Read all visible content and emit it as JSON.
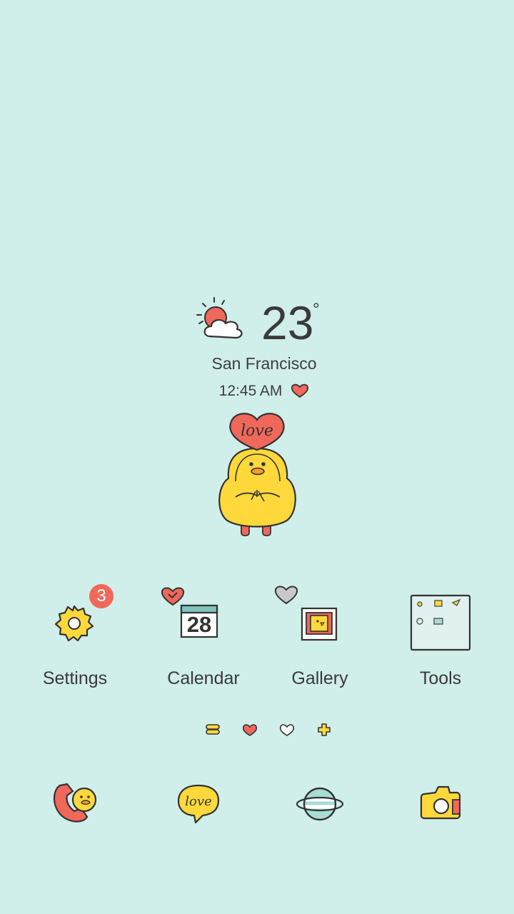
{
  "weather": {
    "icon": "sun-behind-cloud-icon",
    "temperature": "23",
    "degree": "°",
    "city": "San Francisco"
  },
  "clock": {
    "time": "12:45 AM",
    "icon": "heart-icon"
  },
  "mascot": {
    "icon": "duck-holding-love-heart-icon",
    "heart_text": "love"
  },
  "apps": [
    {
      "label": "Settings",
      "icon": "gear-icon",
      "badge": "3"
    },
    {
      "label": "Calendar",
      "icon": "calendar-icon",
      "date": "28"
    },
    {
      "label": "Gallery",
      "icon": "photo-frame-icon"
    },
    {
      "label": "Tools",
      "icon": "tools-folder-icon"
    }
  ],
  "page_indicator": [
    {
      "icon": "yellow-dash-icon"
    },
    {
      "icon": "red-heart-icon"
    },
    {
      "icon": "white-heart-icon"
    },
    {
      "icon": "yellow-cross-icon"
    }
  ],
  "dock": [
    {
      "icon": "phone-duck-icon"
    },
    {
      "icon": "love-chat-bubble-icon",
      "text": "love"
    },
    {
      "icon": "planet-browser-icon"
    },
    {
      "icon": "camera-icon"
    }
  ],
  "colors": {
    "background": "#d0eeea",
    "accent_red": "#f0685a",
    "accent_yellow": "#ffd93b",
    "text": "#3a3a3a"
  }
}
